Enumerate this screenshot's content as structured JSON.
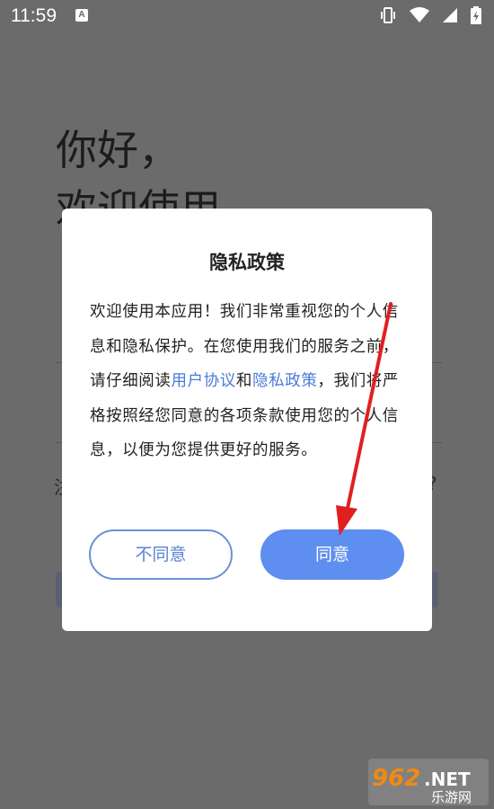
{
  "status_bar": {
    "time": "11:59",
    "notification_badge": "A",
    "icons": [
      "vibrate-icon",
      "wifi-icon",
      "signal-icon",
      "battery-charging-icon"
    ]
  },
  "background": {
    "greeting_line1": "你好，",
    "greeting_line2": "欢迎使用",
    "left_fragment": "注",
    "right_fragment": "?"
  },
  "dialog": {
    "title": "隐私政策",
    "body_part1": "欢迎使用本应用！我们非常重视您的个人信息和隐私保护。在您使用我们的服务之前，请仔细阅读",
    "link_user_agreement": "用户协议",
    "body_and": "和",
    "link_privacy_policy": "隐私政策",
    "body_part2": "，我们将严格按照经您同意的各项条款使用您的个人信息，以便为您提供更好的服务。",
    "disagree_label": "不同意",
    "agree_label": "同意"
  },
  "watermark": {
    "number": "962",
    "suffix": ".NET",
    "site_name": "乐游网"
  },
  "colors": {
    "link": "#4a7bd6",
    "agree_button": "#5e8ef0",
    "disagree_border": "#6b90d8",
    "arrow": "#e02020"
  }
}
